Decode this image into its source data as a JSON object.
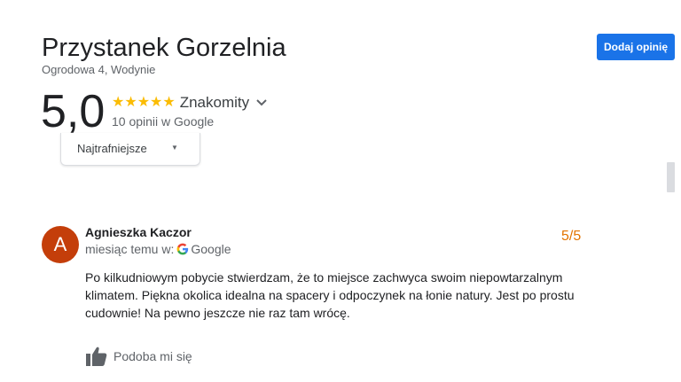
{
  "place": {
    "name": "Przystanek Gorzelnia",
    "address": "Ogrodowa 4, Wodynie"
  },
  "actions": {
    "add_review_label": "Dodaj opinię"
  },
  "rating": {
    "score": "5,0",
    "stars": "★★★★★",
    "star_value": 5,
    "star_color": "#fbbc04",
    "label": "Znakomity",
    "count_text": "10 opinii w Google"
  },
  "sort": {
    "selected": "Najtrafniejsze"
  },
  "reviews": [
    {
      "avatar_letter": "A",
      "avatar_color": "#c43e0a",
      "author": "Agnieszka Kaczor",
      "time_source_prefix": "miesiąc temu w:",
      "source": "Google",
      "score": "5/5",
      "text": "Po kilkudniowym pobycie stwierdzam, że to miejsce zachwyca swoim niepowtarzalnym klimatem. Piękna okolica idealna na spacery i odpoczynek na łonie natury. Jest po prostu cudownie! Na pewno jeszcze nie raz tam wrócę.",
      "like_label": "Podoba mi się"
    }
  ],
  "colors": {
    "accent": "#1a73e8",
    "review_score": "#e37400"
  },
  "icons": {
    "chevron": "chevron-down-icon",
    "google": "google-g-icon",
    "like": "thumb-up-icon"
  }
}
